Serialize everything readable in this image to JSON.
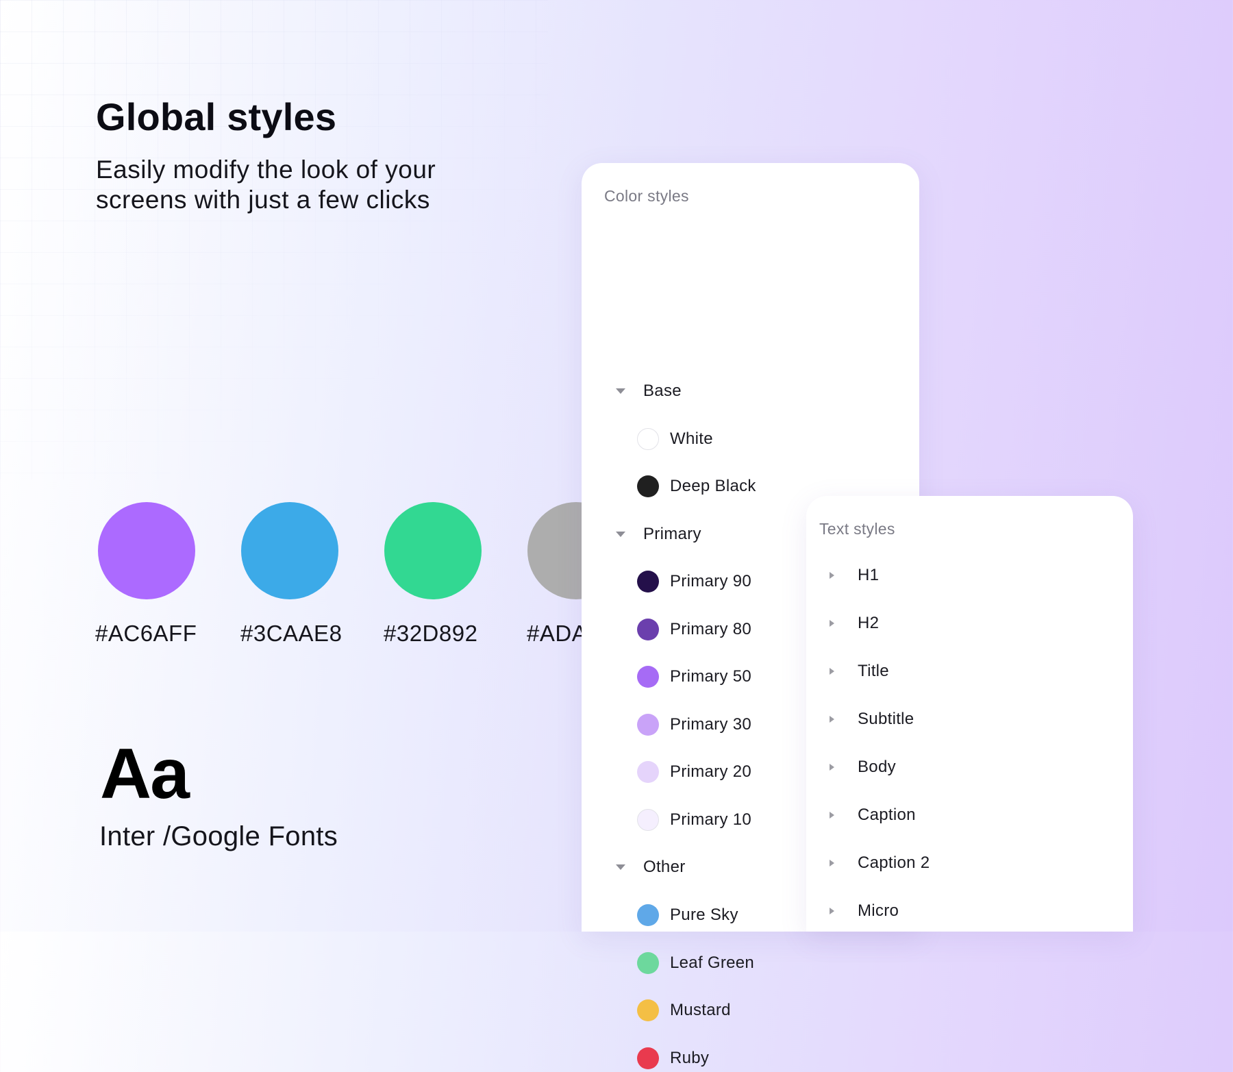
{
  "hero": {
    "title": "Global styles",
    "subtitle": "Easily modify the look of your screens with just a few clicks"
  },
  "swatches": [
    {
      "hex": "#AC6AFF",
      "color": "#AC6AFF"
    },
    {
      "hex": "#3CAAE8",
      "color": "#3CAAE8"
    },
    {
      "hex": "#32D892",
      "color": "#32D892"
    },
    {
      "hex": "#ADA",
      "color": "#ADADAD"
    }
  ],
  "typography": {
    "sample": "Aa",
    "font_name": "Inter /Google Fonts"
  },
  "color_styles": {
    "title": "Color styles",
    "groups": [
      {
        "label": "Base",
        "items": [
          {
            "label": "White",
            "color": "#FFFFFF"
          },
          {
            "label": "Deep Black",
            "color": "#202020"
          }
        ]
      },
      {
        "label": "Primary",
        "items": [
          {
            "label": "Primary 90",
            "color": "#24104A"
          },
          {
            "label": "Primary 80",
            "color": "#6B3FAD"
          },
          {
            "label": "Primary 50",
            "color": "#A66BF5"
          },
          {
            "label": "Primary 30",
            "color": "#C9A3F8"
          },
          {
            "label": "Primary 20",
            "color": "#E5D4FB"
          },
          {
            "label": "Primary 10",
            "color": "#F5EFFE"
          }
        ]
      },
      {
        "label": "Other",
        "items": [
          {
            "label": "Pure Sky",
            "color": "#5FA8E8"
          },
          {
            "label": "Leaf Green",
            "color": "#6DD89D"
          },
          {
            "label": "Mustard",
            "color": "#F4BF45"
          },
          {
            "label": "Ruby",
            "color": "#E93A4E"
          }
        ]
      }
    ]
  },
  "text_styles": {
    "title": "Text styles",
    "items": [
      "H1",
      "H2",
      "Title",
      "Subtitle",
      "Body",
      "Caption",
      "Caption 2",
      "Micro"
    ]
  }
}
